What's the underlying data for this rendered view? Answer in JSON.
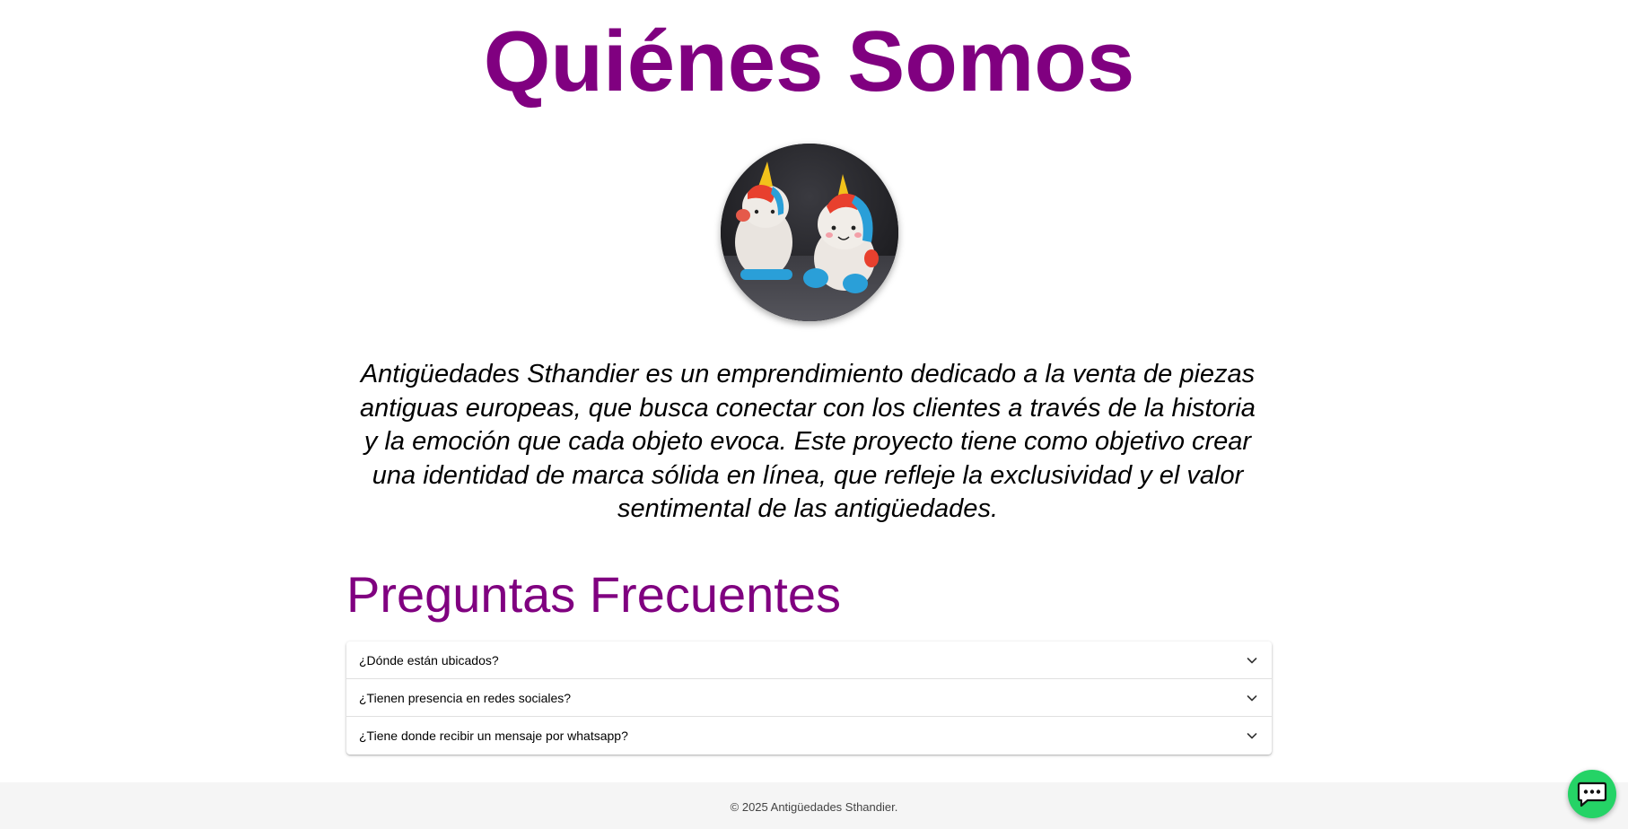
{
  "about": {
    "title": "Quiénes Somos",
    "avatar_icon": "unicorn-figurines-photo",
    "description": "Antigüedades Sthandier es un emprendimiento dedicado a la venta de piezas antiguas europeas, que busca conectar con los clientes a través de la historia y la emoción que cada objeto evoca. Este proyecto tiene como objetivo crear una identidad de marca sólida en línea, que refleje la exclusividad y el valor sentimental de las antigüedades."
  },
  "faq": {
    "title": "Preguntas Frecuentes",
    "items": [
      {
        "question": "¿Dónde están ubicados?",
        "icon": "chevron-down-icon"
      },
      {
        "question": "¿Tienen presencia en redes sociales?",
        "icon": "chevron-down-icon"
      },
      {
        "question": "¿Tiene donde recibir un mensaje por whatsapp?",
        "icon": "chevron-down-icon"
      }
    ]
  },
  "footer": {
    "text": "© 2025 Antigüedades Sthandier."
  },
  "chat": {
    "icon": "chat-bubble-icon"
  },
  "colors": {
    "accent": "#800080",
    "chat_button": "#25d366",
    "footer_bg": "#f5f5f5"
  }
}
